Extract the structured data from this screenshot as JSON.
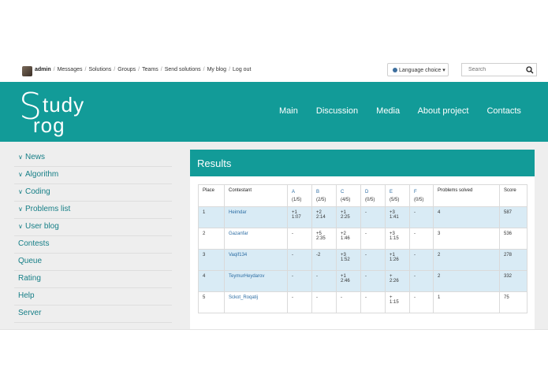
{
  "topbar": {
    "user": "admin",
    "links": [
      "Messages",
      "Solutions",
      "Groups",
      "Teams",
      "Send solutions",
      "My blog",
      "Log out"
    ],
    "language_button": "Language choice",
    "search_placeholder": "Search"
  },
  "header": {
    "logo_top": "tudy",
    "logo_s": "S",
    "logo_bottom": "rog",
    "nav": [
      "Main",
      "Discussion",
      "Media",
      "About project",
      "Contacts"
    ],
    "accent_color": "#129b98"
  },
  "sidebar": {
    "items": [
      {
        "label": "News",
        "expandable": true
      },
      {
        "label": "Algorithm",
        "expandable": true
      },
      {
        "label": "Coding",
        "expandable": true
      },
      {
        "label": "Problems list",
        "expandable": true
      },
      {
        "label": "User blog",
        "expandable": true
      },
      {
        "label": "Contests",
        "expandable": false
      },
      {
        "label": "Queue",
        "expandable": false
      },
      {
        "label": "Rating",
        "expandable": false
      },
      {
        "label": "Help",
        "expandable": false
      },
      {
        "label": "Server",
        "expandable": false
      }
    ]
  },
  "results": {
    "title": "Results",
    "columns": {
      "place": "Place",
      "contestant": "Contestant",
      "problems": [
        {
          "letter": "A",
          "count": "(1/5)"
        },
        {
          "letter": "B",
          "count": "(2/5)"
        },
        {
          "letter": "C",
          "count": "(4/5)"
        },
        {
          "letter": "D",
          "count": "(0/5)"
        },
        {
          "letter": "E",
          "count": "(5/5)"
        },
        {
          "letter": "F",
          "count": "(0/5)"
        }
      ],
      "solved": "Problems solved",
      "score": "Score"
    },
    "rows": [
      {
        "place": "1",
        "name": "Heimdar",
        "cells": [
          [
            "+1",
            "1:07"
          ],
          [
            "+2",
            "2:14"
          ],
          [
            "+1",
            "2:25"
          ],
          [
            "-",
            ""
          ],
          [
            "+3",
            "1:41"
          ],
          [
            "-",
            ""
          ]
        ],
        "solved": "4",
        "score": "587"
      },
      {
        "place": "2",
        "name": "Gazanfar",
        "cells": [
          [
            "-",
            ""
          ],
          [
            "+5",
            "2:35"
          ],
          [
            "+2",
            "1:46"
          ],
          [
            "-",
            ""
          ],
          [
            "+3",
            "1:15"
          ],
          [
            "-",
            ""
          ]
        ],
        "solved": "3",
        "score": "536"
      },
      {
        "place": "3",
        "name": "Vaqif134",
        "cells": [
          [
            "-",
            ""
          ],
          [
            "-2",
            ""
          ],
          [
            "+3",
            "1:52"
          ],
          [
            "-",
            ""
          ],
          [
            "+1",
            "1:26"
          ],
          [
            "-",
            ""
          ]
        ],
        "solved": "2",
        "score": "278"
      },
      {
        "place": "4",
        "name": "TeymurHeydarov",
        "cells": [
          [
            "-",
            ""
          ],
          [
            "-",
            ""
          ],
          [
            "+1",
            "2:46"
          ],
          [
            "-",
            ""
          ],
          [
            "+",
            "2:26"
          ],
          [
            "-",
            ""
          ]
        ],
        "solved": "2",
        "score": "332"
      },
      {
        "place": "5",
        "name": "Sckot_Roqatij",
        "cells": [
          [
            "-",
            ""
          ],
          [
            "-",
            ""
          ],
          [
            "-",
            ""
          ],
          [
            "-",
            ""
          ],
          [
            "+",
            "1:15"
          ],
          [
            "-",
            ""
          ]
        ],
        "solved": "1",
        "score": "75"
      }
    ]
  }
}
